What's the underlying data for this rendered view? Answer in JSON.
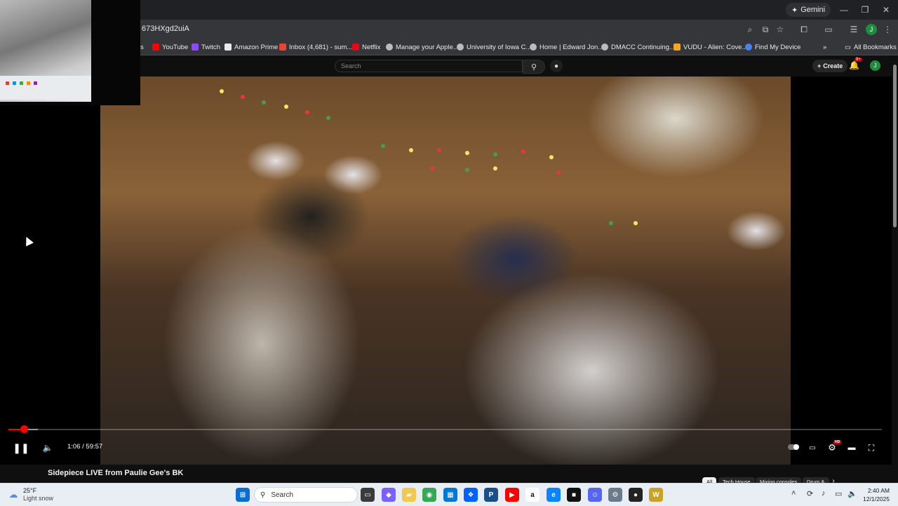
{
  "browser": {
    "gemini_label": "Gemini",
    "url": "673HXgd2uiA",
    "profile_initial": "J",
    "bookmarks": [
      {
        "label": "s"
      },
      {
        "label": "YouTube",
        "color": "#ff0000"
      },
      {
        "label": "Twitch",
        "color": "#9146ff"
      },
      {
        "label": "Amazon Prime",
        "color": "#e8eaed"
      },
      {
        "label": "Inbox (4,681) - sum...",
        "color": "#ea4335"
      },
      {
        "label": "Netflix",
        "color": "#e50914"
      },
      {
        "label": "Manage your Apple...",
        "color": "#bbbbbb"
      },
      {
        "label": "University of Iowa C...",
        "color": "#bbbbbb"
      },
      {
        "label": "Home | Edward Jon...",
        "color": "#bbbbbb"
      },
      {
        "label": "DMACC Continuing...",
        "color": "#bbbbbb"
      },
      {
        "label": "VUDU - Alien: Cove...",
        "color": "#f5a623"
      },
      {
        "label": "Find My Device",
        "color": "#4285f4"
      }
    ],
    "all_bookmarks_label": "All Bookmarks"
  },
  "youtube": {
    "search_placeholder": "Search",
    "create_label": "Create",
    "notification_count": "9+",
    "avatar_initial": "J"
  },
  "player": {
    "progress_fraction": 0.0179,
    "buffer_fraction": 0.0337,
    "time_current": "1:06",
    "time_separator": " / ",
    "time_total": "59:57",
    "time_display": "1:06 / 59:57",
    "hd_badge": "HD"
  },
  "video": {
    "title": "Sidepiece LIVE from Paulie Gee's BK"
  },
  "chips": [
    {
      "label": "All",
      "active": true
    },
    {
      "label": "Tech House",
      "active": false
    },
    {
      "label": "Mixing consoles",
      "active": false
    },
    {
      "label": "Drum &",
      "active": false
    }
  ],
  "taskbar": {
    "weather_temp": "25°F",
    "weather_desc": "Light snow",
    "search_label": "Search",
    "clock_time": "2:40 AM",
    "clock_date": "12/1/2025"
  },
  "colors": {
    "accent_red": "#ff0000",
    "page_bg": "#0f0f0f",
    "taskbar_bg": "#e9eef4"
  }
}
